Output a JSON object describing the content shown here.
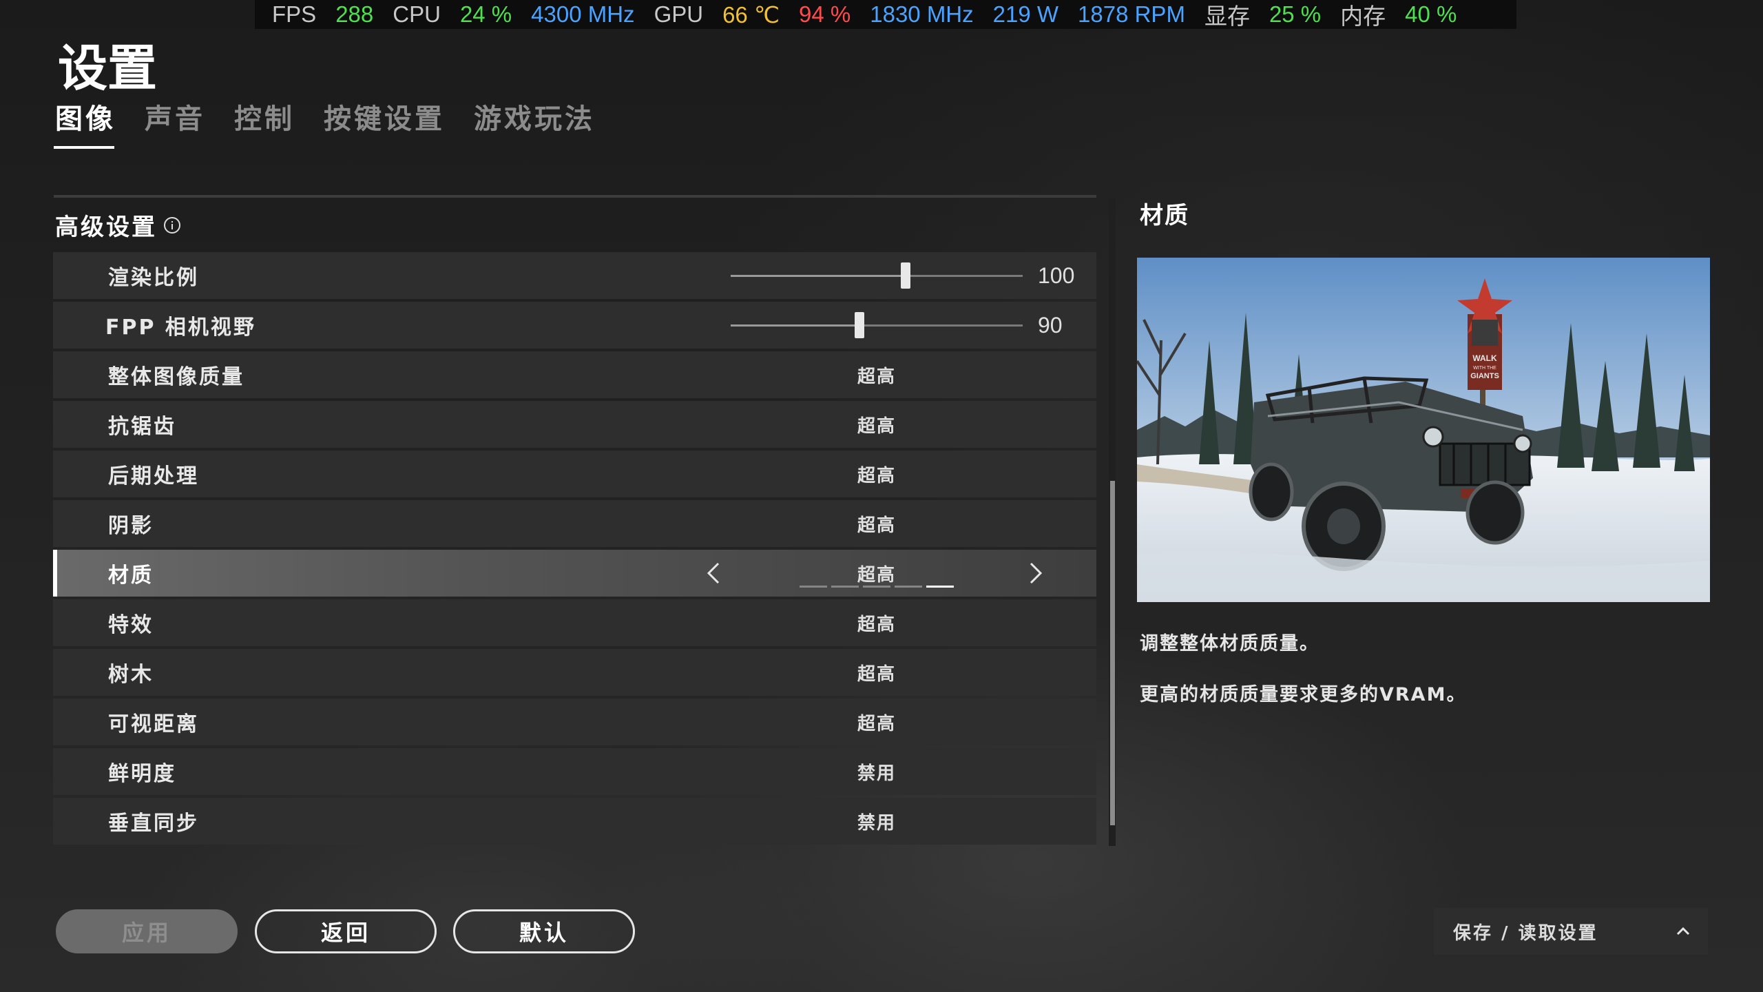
{
  "osd": {
    "fps_label": "FPS",
    "fps": "288",
    "cpu_label": "CPU",
    "cpu_load": "24 %",
    "cpu_clock": "4300 MHz",
    "gpu_label": "GPU",
    "gpu_temp": "66 ℃",
    "gpu_load": "94 %",
    "gpu_clock": "1830 MHz",
    "gpu_power": "219 W",
    "fan": "1878 RPM",
    "vram_label": "显存",
    "vram": "25 %",
    "ram_label": "内存",
    "ram": "40 %"
  },
  "title": "设置",
  "tabs": [
    {
      "label": "图像",
      "active": true
    },
    {
      "label": "声音"
    },
    {
      "label": "控制"
    },
    {
      "label": "按键设置"
    },
    {
      "label": "游戏玩法"
    }
  ],
  "section_title": "高级设置",
  "rows": [
    {
      "label": "渲染比例",
      "type": "slider",
      "value": "100",
      "position": 0.6
    },
    {
      "label": "FPP 相机视野",
      "type": "slider",
      "value": "90",
      "position": 0.44
    },
    {
      "label": "整体图像质量",
      "value": "超高"
    },
    {
      "label": "抗锯齿",
      "value": "超高"
    },
    {
      "label": "后期处理",
      "value": "超高"
    },
    {
      "label": "阴影",
      "value": "超高"
    },
    {
      "label": "材质",
      "value": "超高",
      "selected": true,
      "level": 5,
      "levels": 5
    },
    {
      "label": "特效",
      "value": "超高"
    },
    {
      "label": "树木",
      "value": "超高"
    },
    {
      "label": "可视距离",
      "value": "超高"
    },
    {
      "label": "鲜明度",
      "value": "禁用"
    },
    {
      "label": "垂直同步",
      "value": "禁用"
    }
  ],
  "preview": {
    "title": "材质",
    "sign_text": "WALK WITH THE GIANTS",
    "desc1": "调整整体材质质量。",
    "desc2": "更高的材质质量要求更多的VRAM。"
  },
  "buttons": {
    "apply": "应用",
    "back": "返回",
    "default": "默认"
  },
  "save_load": "保存 / 读取设置"
}
